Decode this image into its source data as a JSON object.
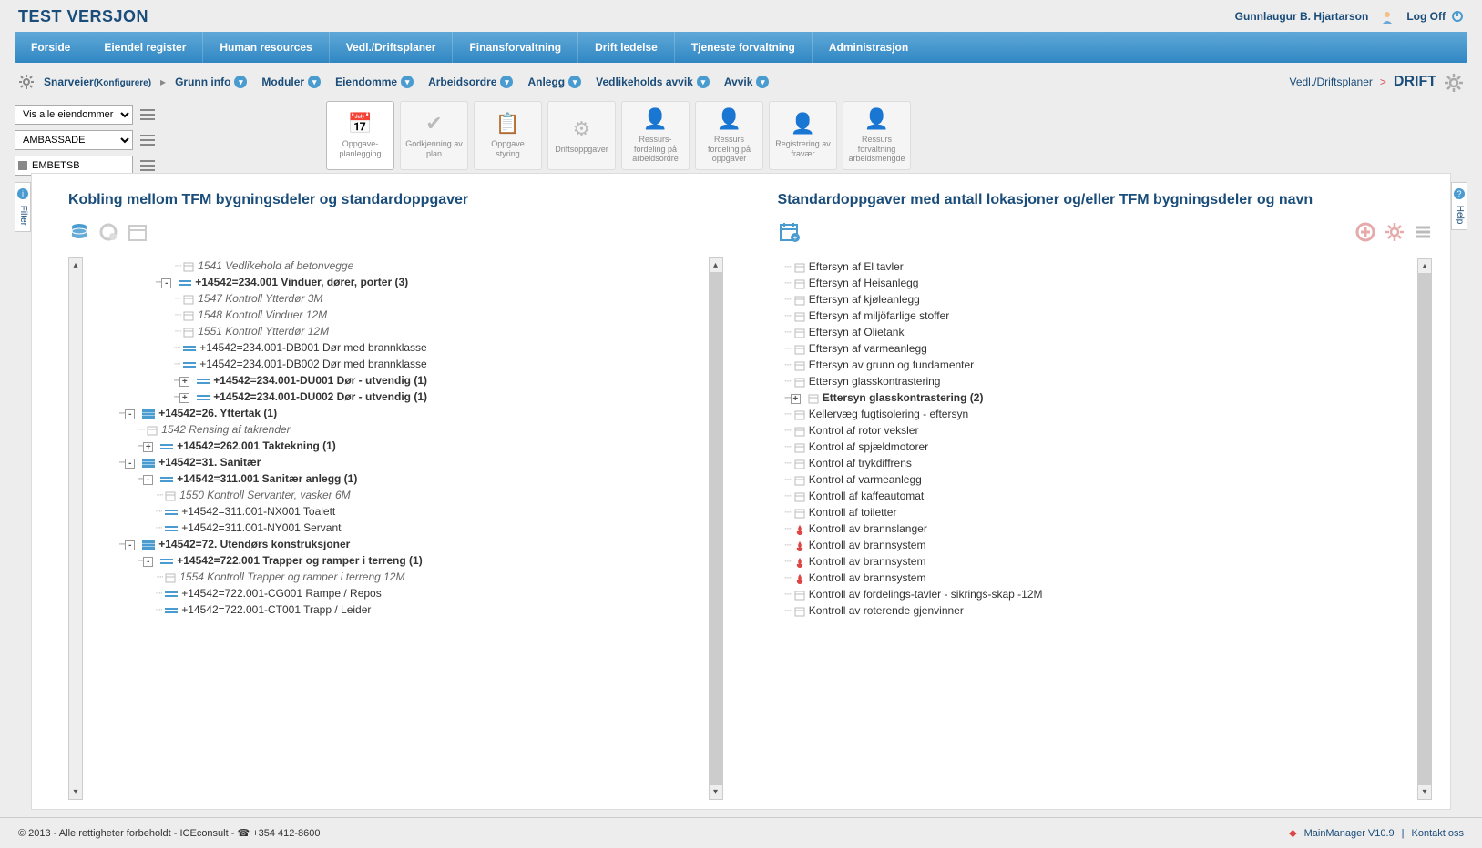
{
  "app_title": "TEST VERSJON",
  "user": {
    "name": "Gunnlaugur B. Hjartarson",
    "logoff": "Log Off"
  },
  "main_nav": [
    "Forside",
    "Eiendel register",
    "Human resources",
    "Vedl./Driftsplaner",
    "Finansforvaltning",
    "Drift ledelse",
    "Tjeneste forvaltning",
    "Administrasjon"
  ],
  "snarveier": {
    "label": "Snarveier",
    "config": "(Konfigurere)"
  },
  "sub_nav": [
    "Grunn info",
    "Moduler",
    "Eiendomme",
    "Arbeidsordre",
    "Anlegg",
    "Vedlikeholds avvik",
    "Avvik"
  ],
  "crumb": {
    "parent": "Vedl./Driftsplaner",
    "current": "DRIFT"
  },
  "filters": {
    "sel1": "Vis alle eiendommer",
    "sel2": "AMBASSADE",
    "inp": "EMBETSB"
  },
  "toolbar": [
    {
      "label": "Oppgave-\nplanlegging",
      "active": true
    },
    {
      "label": "Godkjenning av plan",
      "active": false
    },
    {
      "label": "Oppgave styring",
      "active": false
    },
    {
      "label": "Driftsoppgaver",
      "active": false
    },
    {
      "label": "Ressurs-\nfordeling på arbeidsordre",
      "active": false
    },
    {
      "label": "Ressurs fordeling på oppgaver",
      "active": false
    },
    {
      "label": "Registrering av fravær",
      "active": false
    },
    {
      "label": "Ressurs forvaltning arbeidsmengde",
      "active": false
    }
  ],
  "side_tabs": {
    "left": "Filter",
    "right": "Help"
  },
  "left_panel": {
    "title": "Kobling mellom TFM bygningsdeler og standardoppgaver",
    "tree": [
      {
        "indent": 3,
        "icon": "cal",
        "text": "1541 Vedlikehold af betonvegge",
        "italic": true
      },
      {
        "indent": 2,
        "toggle": "-",
        "icon": "bar",
        "text": "+14542=234.001 Vinduer, dører, porter (3)",
        "bold": true
      },
      {
        "indent": 3,
        "icon": "cal",
        "text": "1547 Kontroll Ytterdør 3M",
        "italic": true
      },
      {
        "indent": 3,
        "icon": "cal",
        "text": "1548 Kontroll Vinduer 12M",
        "italic": true
      },
      {
        "indent": 3,
        "icon": "cal",
        "text": "1551 Kontroll Ytterdør 12M",
        "italic": true
      },
      {
        "indent": 3,
        "icon": "bar",
        "text": "+14542=234.001-DB001 Dør med brannklasse"
      },
      {
        "indent": 3,
        "icon": "bar",
        "text": "+14542=234.001-DB002 Dør med brannklasse"
      },
      {
        "indent": 3,
        "toggle": "+",
        "icon": "bar",
        "text": "+14542=234.001-DU001 Dør - utvendig (1)",
        "bold": true
      },
      {
        "indent": 3,
        "toggle": "+",
        "icon": "bar",
        "text": "+14542=234.001-DU002 Dør - utvendig (1)",
        "bold": true
      },
      {
        "indent": 0,
        "toggle": "-",
        "icon": "folder",
        "text": "+14542=26. Yttertak (1)",
        "bold": true
      },
      {
        "indent": 1,
        "icon": "cal",
        "text": "1542 Rensing af takrender",
        "italic": true
      },
      {
        "indent": 1,
        "toggle": "+",
        "icon": "bar",
        "text": "+14542=262.001 Taktekning (1)",
        "bold": true
      },
      {
        "indent": 0,
        "toggle": "-",
        "icon": "folder",
        "text": "+14542=31. Sanitær",
        "bold": true
      },
      {
        "indent": 1,
        "toggle": "-",
        "icon": "bar",
        "text": "+14542=311.001 Sanitær anlegg (1)",
        "bold": true
      },
      {
        "indent": 2,
        "icon": "cal",
        "text": "1550 Kontroll Servanter, vasker 6M",
        "italic": true
      },
      {
        "indent": 2,
        "icon": "bar",
        "text": "+14542=311.001-NX001 Toalett"
      },
      {
        "indent": 2,
        "icon": "bar",
        "text": "+14542=311.001-NY001 Servant"
      },
      {
        "indent": 0,
        "toggle": "-",
        "icon": "folder",
        "text": "+14542=72. Utendørs konstruksjoner",
        "bold": true
      },
      {
        "indent": 1,
        "toggle": "-",
        "icon": "bar",
        "text": "+14542=722.001 Trapper og ramper i terreng (1)",
        "bold": true
      },
      {
        "indent": 2,
        "icon": "cal",
        "text": "1554 Kontroll Trapper og ramper i terreng 12M",
        "italic": true
      },
      {
        "indent": 2,
        "icon": "bar",
        "text": "+14542=722.001-CG001 Rampe / Repos"
      },
      {
        "indent": 2,
        "icon": "bar",
        "text": "+14542=722.001-CT001 Trapp / Leider"
      }
    ]
  },
  "right_panel": {
    "title": "Standardoppgaver med antall lokasjoner og/eller TFM bygningsdeler og navn",
    "tree": [
      {
        "icon": "cal",
        "text": "Eftersyn af El tavler"
      },
      {
        "icon": "cal",
        "text": "Eftersyn af Heisanlegg"
      },
      {
        "icon": "cal",
        "text": "Eftersyn af kjøleanlegg"
      },
      {
        "icon": "cal",
        "text": "Eftersyn af miljöfarlige stoffer"
      },
      {
        "icon": "cal",
        "text": "Eftersyn af Olietank"
      },
      {
        "icon": "cal",
        "text": "Eftersyn af varmeanlegg"
      },
      {
        "icon": "cal",
        "text": "Ettersyn av grunn og fundamenter"
      },
      {
        "icon": "cal",
        "text": "Ettersyn glasskontrastering"
      },
      {
        "toggle": "+",
        "icon": "cal",
        "text": "Ettersyn glasskontrastering (2)",
        "bold": true
      },
      {
        "icon": "cal",
        "text": "Kellervæg fugtisolering - eftersyn"
      },
      {
        "icon": "cal",
        "text": "Kontrol af rotor veksler"
      },
      {
        "icon": "cal",
        "text": "Kontrol af spjældmotorer"
      },
      {
        "icon": "cal",
        "text": "Kontrol af trykdiffrens"
      },
      {
        "icon": "cal",
        "text": "Kontrol af varmeanlegg"
      },
      {
        "icon": "cal",
        "text": "Kontroll af kaffeautomat"
      },
      {
        "icon": "cal",
        "text": "Kontroll af toiletter"
      },
      {
        "icon": "fire",
        "text": "Kontroll av brannslanger"
      },
      {
        "icon": "fire",
        "text": "Kontroll av brannsystem"
      },
      {
        "icon": "fire",
        "text": "Kontroll av brannsystem"
      },
      {
        "icon": "fire",
        "text": "Kontroll av brannsystem"
      },
      {
        "icon": "cal",
        "text": "Kontroll av fordelings-tavler - sikrings-skap -12M"
      },
      {
        "icon": "cal",
        "text": "Kontroll av roterende gjenvinner"
      }
    ]
  },
  "footer": {
    "left": "© 2013 - Alle rettigheter forbeholdt - ICEconsult - ☎ +354 412-8600",
    "right_version": "MainManager V10.9",
    "right_contact": "Kontakt oss"
  }
}
